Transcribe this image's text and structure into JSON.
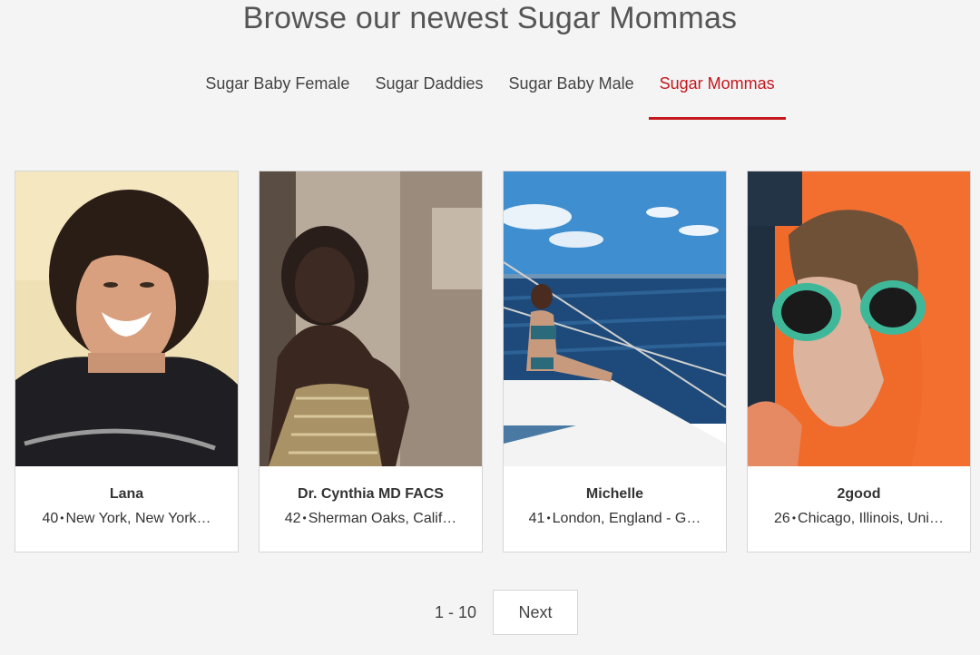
{
  "page_title": "Browse our newest Sugar Mommas",
  "tabs": [
    {
      "label": "Sugar Baby Female",
      "active": false
    },
    {
      "label": "Sugar Daddies",
      "active": false
    },
    {
      "label": "Sugar Baby Male",
      "active": false
    },
    {
      "label": "Sugar Mommas",
      "active": true
    }
  ],
  "profiles": [
    {
      "name": "Lana",
      "age": "40",
      "location": "New York, New York…"
    },
    {
      "name": "Dr. Cynthia MD FACS",
      "age": "42",
      "location": "Sherman Oaks, Calif…"
    },
    {
      "name": "Michelle",
      "age": "41",
      "location": "London, England - G…"
    },
    {
      "name": "2good",
      "age": "26",
      "location": "Chicago, Illinois, Uni…"
    }
  ],
  "pagination": {
    "range": "1 - 10",
    "next_label": "Next"
  },
  "colors": {
    "accent": "#c4161c",
    "background": "#f4f4f4",
    "card": "#ffffff"
  }
}
